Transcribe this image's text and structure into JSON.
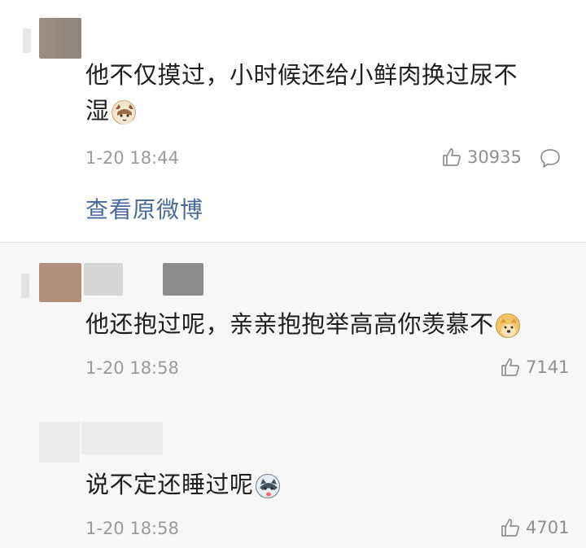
{
  "comments": [
    {
      "text_line1": "他不仅摸过，小时候还给小鲜肉换过尿不",
      "text_line2": "湿",
      "emoji": "cat-face-emoji",
      "time": "1-20 18:44",
      "likes": "30935",
      "link": "查看原微博"
    },
    {
      "text": "他还抱过呢，亲亲抱抱举高高你羡慕不",
      "emoji": "doge-emoji",
      "time": "1-20 18:58",
      "likes": "7141"
    },
    {
      "text": "说不定还睡过呢",
      "emoji": "husky-emoji",
      "time": "1-20 18:58",
      "likes": "4701"
    }
  ],
  "colors": {
    "link": "#4a6a9a",
    "meta": "#9a9a9a",
    "reply_bg": "#f7f7f7"
  }
}
